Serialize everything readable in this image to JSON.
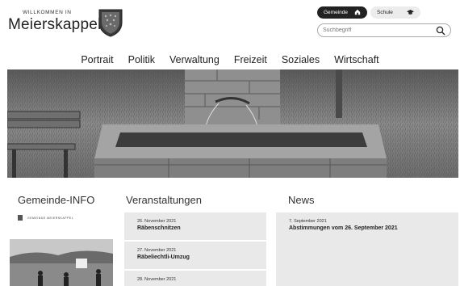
{
  "header": {
    "logo_small": "WILLKOMMEN IN",
    "logo_big": "Meierskappel",
    "toggle": {
      "gemeinde_label": "Gemeinde",
      "gemeinde_icon": "home-icon",
      "schule_label": "Schule",
      "schule_icon": "graduation-cap-icon"
    },
    "search": {
      "placeholder": "Suchbegriff",
      "icon": "search-icon"
    }
  },
  "nav": {
    "items": [
      "Portrait",
      "Politik",
      "Verwaltung",
      "Freizeit",
      "Soziales",
      "Wirtschaft"
    ]
  },
  "sections": {
    "gemeinde_info": {
      "title": "Gemeinde-INFO",
      "header_text": "GEMEINDE MEIERSKAPPEL"
    },
    "veranstaltungen": {
      "title": "Veranstaltungen",
      "items": [
        {
          "date": "26. November 2021",
          "title": "Räbenschnitzen"
        },
        {
          "date": "27. November 2021",
          "title": "Räbeliechtli-Umzug"
        },
        {
          "date": "28. November 2021",
          "title": ""
        }
      ]
    },
    "news": {
      "title": "News",
      "items": [
        {
          "date": "7. September 2021",
          "title": "Abstimmungen vom 26. September 2021"
        }
      ]
    }
  },
  "colors": {
    "card_bg": "#e9e9e9",
    "toggle_active": "#222222",
    "toggle_inactive": "#ececec"
  }
}
